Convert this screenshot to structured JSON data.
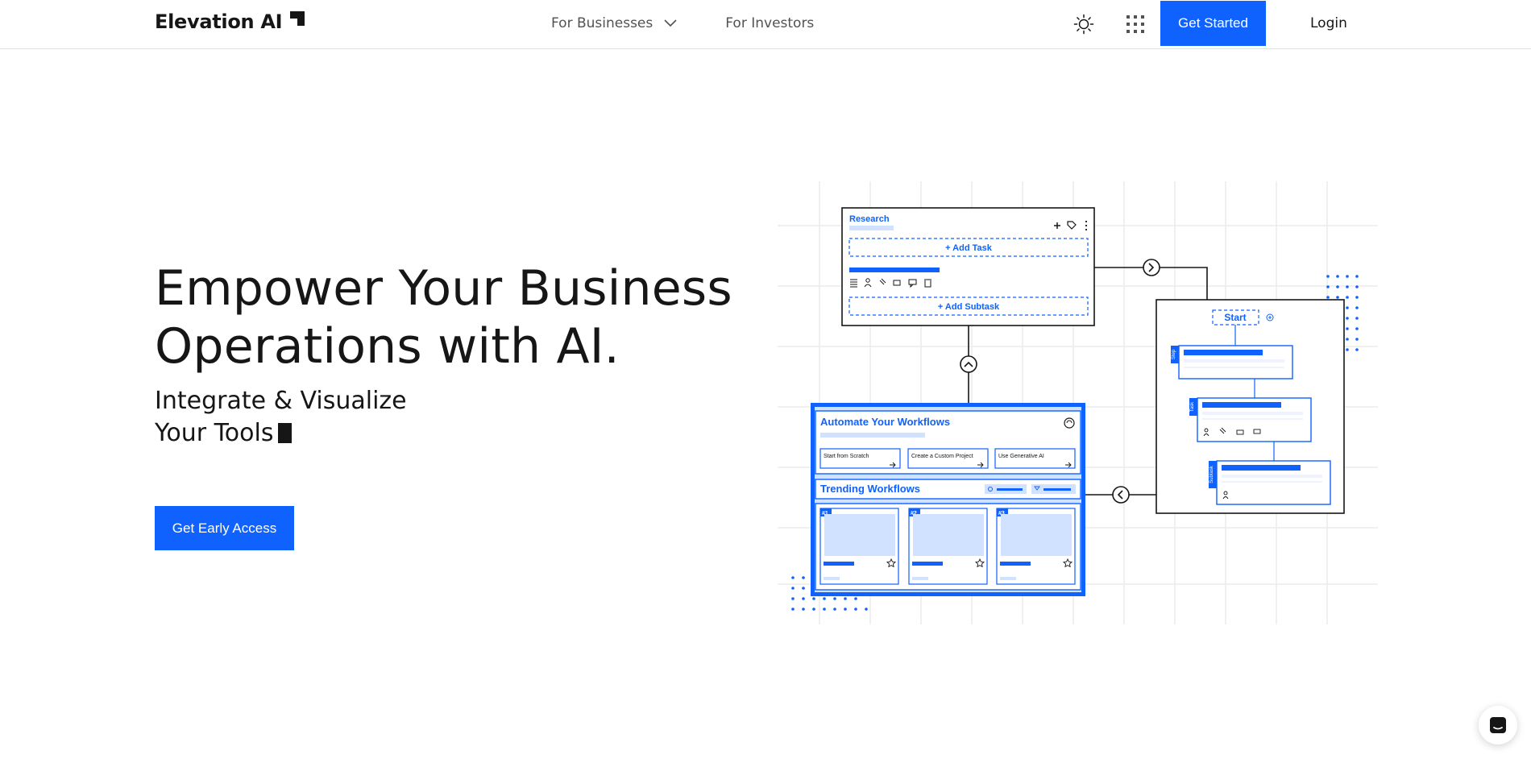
{
  "header": {
    "logo_text": "Elevation AI",
    "nav": [
      {
        "label": "For Businesses",
        "has_dropdown": true
      },
      {
        "label": "For Investors",
        "has_dropdown": false
      }
    ],
    "theme_icon": "sun-icon",
    "apps_icon": "grid-icon",
    "get_started_label": "Get Started",
    "login_label": "Login"
  },
  "hero": {
    "title_line1": "Empower Your Business",
    "title_line2": "Operations with AI.",
    "subtitle_line1": "Integrate & Visualize",
    "subtitle_line2": "Your Tools",
    "cta_label": "Get Early Access"
  },
  "illustration": {
    "research_title": "Research",
    "add_task": "+  Add Task",
    "add_subtask": "+  Add Subtask",
    "start_label": "Start",
    "automate_title": "Automate Your Workflows",
    "options": [
      "Start from Scratch",
      "Create a Custom Project",
      "Use Generative AI"
    ],
    "trending_title": "Trending Workflows",
    "ranks": [
      "#1",
      "#2",
      "#3"
    ],
    "side_tags": [
      "Step",
      "Task",
      "Subtask"
    ]
  },
  "colors": {
    "accent": "#0f62fe",
    "text": "#161616",
    "muted": "#525252",
    "light_blue": "#d0e2ff",
    "grid": "#e8e8e8"
  },
  "chat_icon": "chat-icon"
}
